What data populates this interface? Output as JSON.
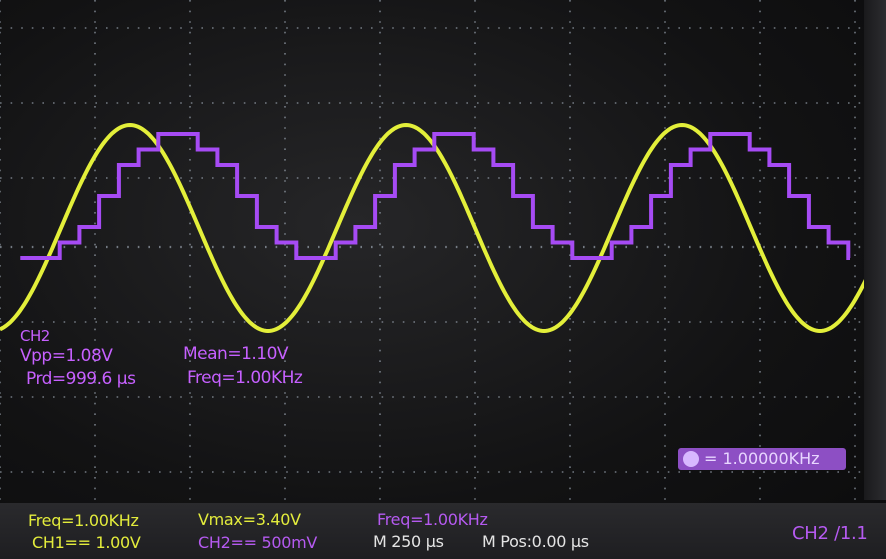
{
  "measurements": {
    "channel_tag": "CH2",
    "vpp": "Vpp=1.08V",
    "period": "Prd=999.6 µs",
    "mean": "Mean=1.10V",
    "frequency": "Freq=1.00KHz"
  },
  "counter": {
    "readout": "= 1.00000KHz",
    "icon": "counter-icon"
  },
  "status": {
    "ch1_freq": "Freq=1.00KHz",
    "ch1_scale": "CH1== 1.00V",
    "vmax": "Vmax=3.40V",
    "ch2_scale": "CH2== 500mV",
    "ch2_freq": "Freq=1.00KHz",
    "timebase": "M 250 µs",
    "mpos": "M Pos:0.00 µs",
    "trigger": "CH2 /1.1"
  },
  "colors": {
    "ch1_trace": "#e3ef3a",
    "ch2_trace": "#a64bf4",
    "grid": "#9aa4b0",
    "counter_bg": "#8d4fc4"
  },
  "chart_data": {
    "type": "line",
    "series": [
      {
        "channel": "CH1",
        "waveform": "sine",
        "frequency_hz": 1000,
        "vpp": 3.4,
        "color": "#e3ef3a"
      },
      {
        "channel": "CH2",
        "waveform": "stepped sine",
        "steps_per_half_cycle": 7,
        "frequency_hz": 1000,
        "vpp": 1.08,
        "mean": 1.1,
        "color": "#a64bf4"
      }
    ],
    "timebase": "250 µs/div",
    "grid": true
  }
}
